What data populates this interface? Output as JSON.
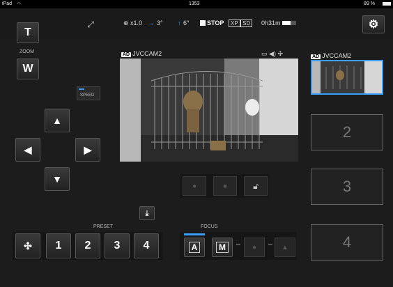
{
  "status_bar": {
    "device": "iPad",
    "time": "1353",
    "battery": "89 %"
  },
  "top_info": {
    "zoom": "x1.0",
    "pan": "3°",
    "tilt": "6°",
    "record_state": "STOP",
    "quality": "XP",
    "media": "SD",
    "time_left": "0h31m"
  },
  "zoom": {
    "tele_label": "T",
    "label": "ZOOM",
    "wide_label": "W"
  },
  "speed_label": "SPEED",
  "camera": {
    "badge": "AD",
    "name": "JVCCAM2"
  },
  "thumb": {
    "badge": "AD",
    "name": "JVCCAM2"
  },
  "slots": [
    "2",
    "3",
    "4"
  ],
  "preset": {
    "label": "PRESET",
    "buttons": [
      "1",
      "2",
      "3",
      "4"
    ]
  },
  "focus": {
    "label": "FOCUS",
    "auto_label": "A",
    "manual_label": "M"
  },
  "colors": {
    "accent": "#3aa0ff",
    "background": "#1c1c1c"
  }
}
